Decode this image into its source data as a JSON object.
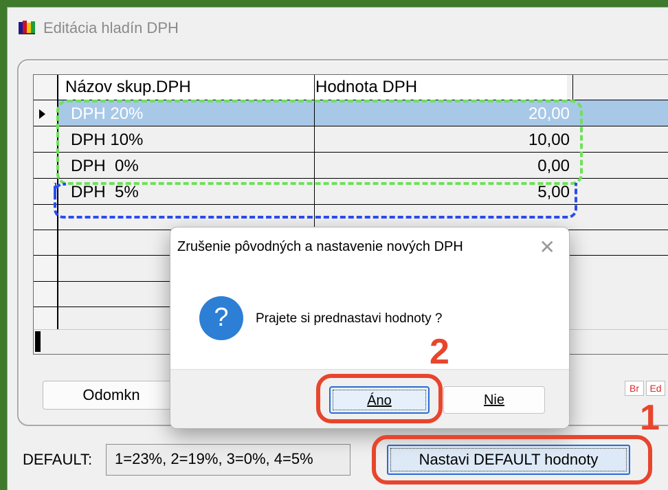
{
  "window": {
    "title": "Editácia hladín DPH",
    "icon": "app-icon"
  },
  "grid": {
    "columns": [
      "Názov skup.DPH",
      "Hodnota DPH"
    ],
    "rows": [
      {
        "name": "DPH 20%",
        "value": "20,00",
        "selected": true
      },
      {
        "name": "DPH 10%",
        "value": "10,00"
      },
      {
        "name": "DPH  0%",
        "value": "0,00"
      },
      {
        "name": "DPH  5%",
        "value": "5,00"
      }
    ]
  },
  "buttons": {
    "unlock": "Odomkn"
  },
  "mini_buttons": [
    "Br",
    "Ed"
  ],
  "default": {
    "label": "DEFAULT:",
    "value": "1=23%, 2=19%, 3=0%, 4=5%",
    "set_button": "Nastavi DEFAULT hodnoty"
  },
  "dialog": {
    "title": "Zrušenie pôvodných a nastavenie nových DPH",
    "close_icon": "✕",
    "icon": "question-icon",
    "message": "Prajete si prednastavi hodnoty ?",
    "yes": "Áno",
    "no": "Nie"
  },
  "annotations": {
    "step1": "1",
    "step2": "2"
  },
  "colors": {
    "annotation": "#e8452d",
    "selection": "#a8c8e8",
    "green_dash": "#6fe05a",
    "blue_dash": "#2a4cf0"
  }
}
